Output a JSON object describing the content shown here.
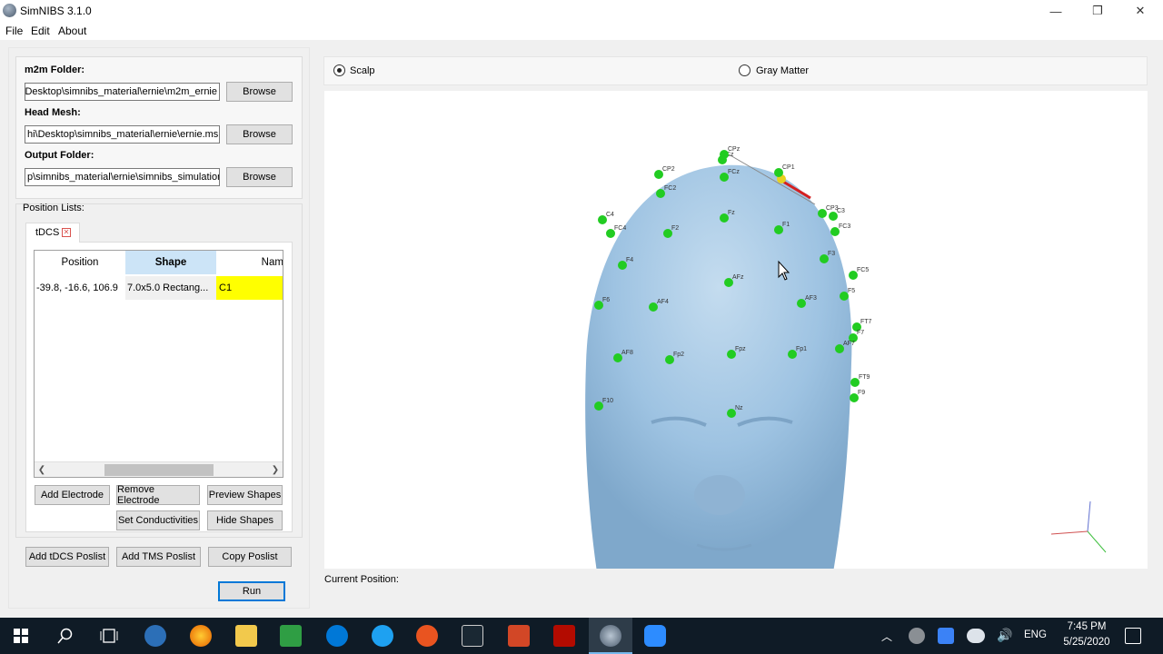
{
  "window": {
    "title": "SimNIBS 3.1.0",
    "controls": {
      "minimize": "—",
      "restore": "❐",
      "close": "✕"
    }
  },
  "menu": [
    "File",
    "Edit",
    "About"
  ],
  "fields": {
    "m2m": {
      "label": "m2m Folder:",
      "value": "\\Desktop\\simnibs_material\\ernie\\m2m_ernie",
      "button": "Browse"
    },
    "head_mesh": {
      "label": "Head Mesh:",
      "value": "hi\\Desktop\\simnibs_material\\ernie\\ernie.msh",
      "button": "Browse"
    },
    "output": {
      "label": "Output Folder:",
      "value": "p\\simnibs_material\\ernie\\simnibs_simulation",
      "button": "Browse"
    }
  },
  "position_lists": {
    "label": "Position Lists:",
    "tab": "tDCS",
    "columns": [
      "Position",
      "Shape",
      "Name"
    ],
    "rows": [
      {
        "position": "-39.8, -16.6, 106.9",
        "shape": "7.0x5.0 Rectang...",
        "name": "C1"
      }
    ]
  },
  "buttons": {
    "add_electrode": "Add Electrode",
    "remove_electrode": "Remove Electrode",
    "preview_shapes": "Preview Shapes",
    "set_conductivities": "Set Conductivities",
    "hide_shapes": "Hide Shapes",
    "add_tdcs_poslist": "Add tDCS Poslist",
    "add_tms_poslist": "Add TMS Poslist",
    "copy_poslist": "Copy Poslist",
    "run": "Run"
  },
  "viewer": {
    "surface_options": [
      {
        "label": "Scalp",
        "selected": true
      },
      {
        "label": "Gray Matter",
        "selected": false
      }
    ],
    "electrode_labels": [
      "Cz",
      "CPz",
      "CP1",
      "CP2",
      "CP3",
      "C3",
      "C4",
      "FC2",
      "FCz",
      "Fz",
      "F2",
      "F1",
      "F3",
      "FC3",
      "FC4",
      "F4",
      "AFz",
      "AF4",
      "AF3",
      "F5",
      "FC5",
      "F6",
      "FT7",
      "F7",
      "AF8",
      "Fp2",
      "Fpz",
      "Fp1",
      "AF7",
      "FT9",
      "F9",
      "Nz",
      "F10"
    ],
    "current_position_label": "Current Position:"
  },
  "taskbar": {
    "language": "ENG",
    "time": "7:45 PM",
    "date": "5/25/2020"
  }
}
